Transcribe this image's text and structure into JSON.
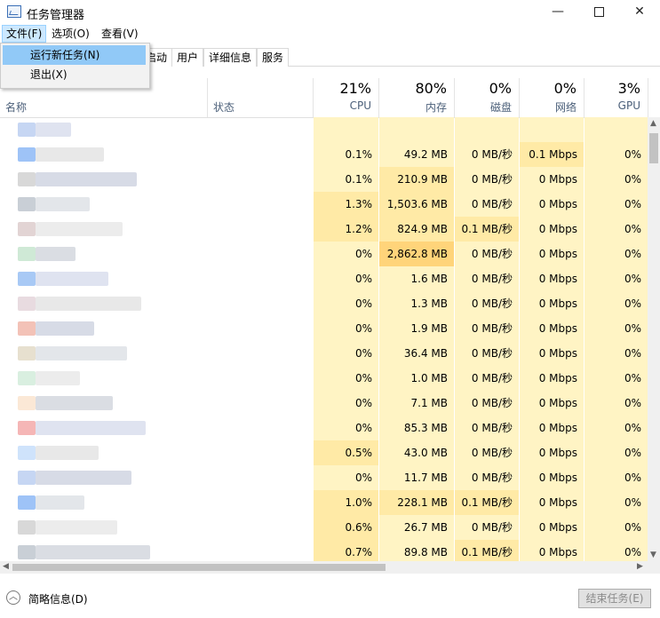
{
  "window": {
    "title": "任务管理器",
    "minimize": "—",
    "close": "✕"
  },
  "menu": {
    "file": "文件(F)",
    "options": "选项(O)",
    "view": "查看(V)"
  },
  "file_menu": {
    "run_new_task": "运行新任务(N)",
    "exit": "退出(X)"
  },
  "tabs": [
    "启动",
    "用户",
    "详细信息",
    "服务"
  ],
  "columns": {
    "name": "名称",
    "status": "状态",
    "cpu": {
      "pct": "21%",
      "label": "CPU"
    },
    "memory": {
      "pct": "80%",
      "label": "内存"
    },
    "disk": {
      "pct": "0%",
      "label": "磁盘"
    },
    "network": {
      "pct": "0%",
      "label": "网络"
    },
    "gpu": {
      "pct": "3%",
      "label": "GPU"
    }
  },
  "rows": [
    {
      "cpu": "",
      "mem": "",
      "disk": "",
      "net": "",
      "gpu": ""
    },
    {
      "cpu": "0.1%",
      "mem": "49.2 MB",
      "disk": "0 MB/秒",
      "net": "0.1 Mbps",
      "gpu": "0%"
    },
    {
      "cpu": "0.1%",
      "mem": "210.9 MB",
      "disk": "0 MB/秒",
      "net": "0 Mbps",
      "gpu": "0%"
    },
    {
      "cpu": "1.3%",
      "mem": "1,503.6 MB",
      "disk": "0 MB/秒",
      "net": "0 Mbps",
      "gpu": "0%"
    },
    {
      "cpu": "1.2%",
      "mem": "824.9 MB",
      "disk": "0.1 MB/秒",
      "net": "0 Mbps",
      "gpu": "0%"
    },
    {
      "cpu": "0%",
      "mem": "2,862.8 MB",
      "disk": "0 MB/秒",
      "net": "0 Mbps",
      "gpu": "0%"
    },
    {
      "cpu": "0%",
      "mem": "1.6 MB",
      "disk": "0 MB/秒",
      "net": "0 Mbps",
      "gpu": "0%"
    },
    {
      "cpu": "0%",
      "mem": "1.3 MB",
      "disk": "0 MB/秒",
      "net": "0 Mbps",
      "gpu": "0%"
    },
    {
      "cpu": "0%",
      "mem": "1.9 MB",
      "disk": "0 MB/秒",
      "net": "0 Mbps",
      "gpu": "0%"
    },
    {
      "cpu": "0%",
      "mem": "36.4 MB",
      "disk": "0 MB/秒",
      "net": "0 Mbps",
      "gpu": "0%"
    },
    {
      "cpu": "0%",
      "mem": "1.0 MB",
      "disk": "0 MB/秒",
      "net": "0 Mbps",
      "gpu": "0%"
    },
    {
      "cpu": "0%",
      "mem": "7.1 MB",
      "disk": "0 MB/秒",
      "net": "0 Mbps",
      "gpu": "0%"
    },
    {
      "cpu": "0%",
      "mem": "85.3 MB",
      "disk": "0 MB/秒",
      "net": "0 Mbps",
      "gpu": "0%"
    },
    {
      "cpu": "0.5%",
      "mem": "43.0 MB",
      "disk": "0 MB/秒",
      "net": "0 Mbps",
      "gpu": "0%"
    },
    {
      "cpu": "0%",
      "mem": "11.7 MB",
      "disk": "0 MB/秒",
      "net": "0 Mbps",
      "gpu": "0%"
    },
    {
      "cpu": "1.0%",
      "mem": "228.1 MB",
      "disk": "0.1 MB/秒",
      "net": "0 Mbps",
      "gpu": "0%"
    },
    {
      "cpu": "0.6%",
      "mem": "26.7 MB",
      "disk": "0 MB/秒",
      "net": "0 Mbps",
      "gpu": "0%"
    },
    {
      "cpu": "0.7%",
      "mem": "89.8 MB",
      "disk": "0.1 MB/秒",
      "net": "0 Mbps",
      "gpu": "0%"
    }
  ],
  "footer": {
    "fewer_details": "简略信息(D)",
    "end_task": "结束任务(E)"
  },
  "colors": {
    "heat_light": "#fff4c4",
    "heat_mid": "#ffeaa6",
    "heat_high": "#ffd47a",
    "selection": "#91c9f7"
  }
}
